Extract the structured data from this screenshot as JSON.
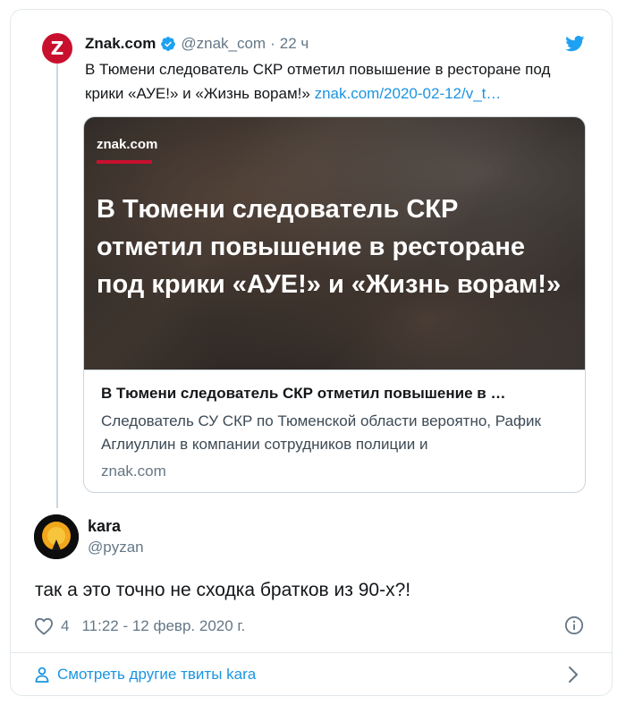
{
  "quoted": {
    "account_name": "Znak.com",
    "avatar_letter": "Z",
    "handle": "@znak_com",
    "separator": "·",
    "time": "22 ч",
    "text": "В Тюмени следователь СКР отметил повышение в ресторане под крики «АУЕ!» и «Жизнь ворам!»",
    "link": "znak.com/2020-02-12/v_t…",
    "card": {
      "image_brand": "znak.com",
      "image_headline": "В Тюмени следователь СКР отметил повышение в ресторане под крики «АУЕ!» и «Жизнь ворам!»",
      "title": "В Тюмени следователь СКР отметил повышение в …",
      "description": "Следователь СУ СКР по Тюменской области вероятно, Рафик Аглиуллин в компании сотрудников полиции и",
      "domain": "znak.com"
    }
  },
  "tweet": {
    "name": "kara",
    "handle": "@pyzan",
    "text": "так а это точно не сходка братков из 90-х?!",
    "likes": "4",
    "timestamp": "11:22 - 12 февр. 2020 г.",
    "more_tweets_label": "Смотреть другие твиты kara"
  },
  "icons": {
    "verified": "verified-badge-icon",
    "bird": "twitter-bird-icon",
    "heart": "heart-icon",
    "info": "info-icon",
    "person": "person-icon",
    "chevron": "chevron-right-icon"
  },
  "colors": {
    "link": "#1b95e0",
    "brand_red": "#c8102e",
    "muted": "#657786",
    "border": "#e1e8ed"
  }
}
